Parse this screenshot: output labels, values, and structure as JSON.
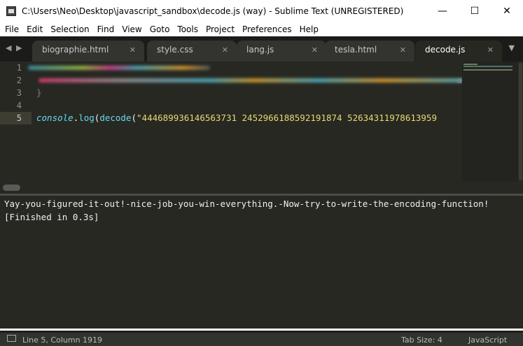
{
  "window": {
    "title": "C:\\Users\\Neo\\Desktop\\javascript_sandbox\\decode.js (way) - Sublime Text (UNREGISTERED)"
  },
  "menu": [
    "File",
    "Edit",
    "Selection",
    "Find",
    "View",
    "Goto",
    "Tools",
    "Project",
    "Preferences",
    "Help"
  ],
  "tabs": [
    {
      "label": "biographie.html"
    },
    {
      "label": "style.css"
    },
    {
      "label": "lang.js"
    },
    {
      "label": "tesla.html"
    },
    {
      "label": "decode.js",
      "active": true
    }
  ],
  "editor": {
    "line_numbers": [
      "1",
      "2",
      "3",
      "4",
      "5"
    ],
    "current_line": 5,
    "line3": "}",
    "line2_tail": "a",
    "line5": {
      "obj": "console",
      "dot": ".",
      "method": "log",
      "paren": "(",
      "fn": "decode",
      "paren2": "(",
      "string": "\"444689936146563731 2452966188592191874 52634311978613959"
    }
  },
  "output": {
    "lines": [
      "Yay-you-figured-it-out!-nice-job-you-win-everything.-Now-try-to-write-the-encoding-function!",
      "[Finished in 0.3s]"
    ]
  },
  "status": {
    "position": "Line 5, Column 1919",
    "tab_size": "Tab Size: 4",
    "syntax": "JavaScript"
  },
  "colors": {
    "editor_bg": "#272822",
    "keyword_blue": "#66d9ef",
    "string": "#e6db74",
    "statusbar": "#32332e"
  }
}
